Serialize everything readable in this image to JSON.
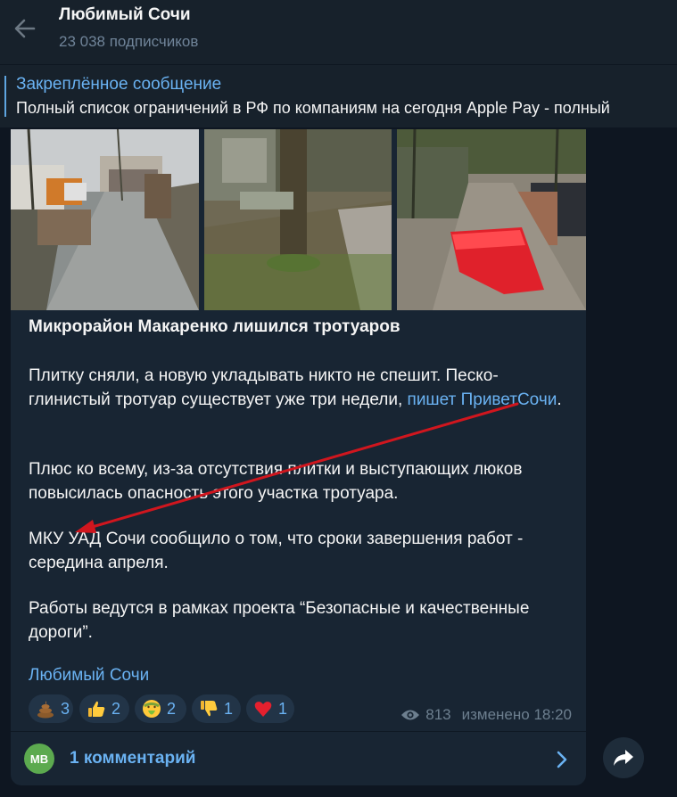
{
  "header": {
    "title": "Любимый Сочи",
    "subscribers": "23 038 подписчиков"
  },
  "pinned": {
    "title": "Закреплённое сообщение",
    "text": "Полный список ограничений в РФ по компаниям на сегодня    Apple Pay - полный"
  },
  "post": {
    "title": "Микрорайон Макаренко лишился тротуаров",
    "p1_text": "Плитку сняли, а новую укладывать никто не спешит. Песко-глинистый тротуар существует уже три недели, ",
    "p1_link": "пишет ПриветСочи",
    "p1_end": ".",
    "p2": "Плюс ко всему, из-за отсутствия плитки и выступающих люков повысилась опасность этого участка тротуара.",
    "p3": "МКУ УАД Сочи сообщило о том, что сроки завершения работ - середина апреля.",
    "p4": "Работы ведутся в рамках проекта “Безопасные и качественные дороги”.",
    "signature": "Любимый Сочи",
    "reactions": [
      {
        "icon": "poop-emoji",
        "count": "3"
      },
      {
        "icon": "thumbs-up-emoji",
        "count": "2"
      },
      {
        "icon": "vomiting-face-emoji",
        "count": "2"
      },
      {
        "icon": "thumbs-down-emoji",
        "count": "1"
      },
      {
        "icon": "red-heart-emoji",
        "count": "1"
      }
    ],
    "views": "813",
    "edited": "изменено 18:20",
    "comments": {
      "avatar_initials": "MB",
      "label": "1 комментарий"
    }
  },
  "colors": {
    "background": "#0e1621",
    "panel": "#17212b",
    "bubble": "#182533",
    "accent": "#6ab2f2",
    "annotation_arrow": "#d0161e"
  }
}
